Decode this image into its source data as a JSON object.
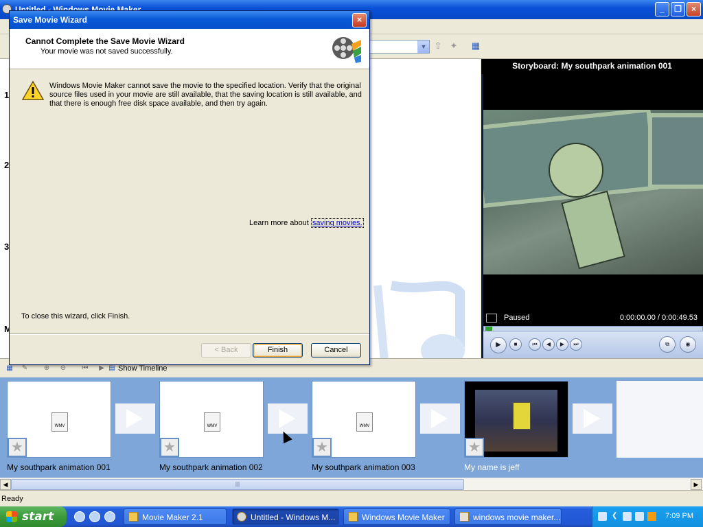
{
  "main_window": {
    "title": "Untitled - Windows Movie Maker",
    "collection_numbers": [
      "1",
      "2",
      "3",
      "M"
    ]
  },
  "preview": {
    "title": "Storyboard: My southpark animation 001",
    "status": "Paused",
    "time": "0:00:00.00 / 0:00:49.53"
  },
  "dialog": {
    "title": "Save Movie Wizard",
    "heading": "Cannot Complete the Save Movie Wizard",
    "subheading": "Your movie was not saved successfully.",
    "message": "Windows Movie Maker cannot save the movie to the specified location. Verify that the original source files used in your movie are still available, that the saving location is still available, and that there is enough free disk space available, and then try again.",
    "learn_more_prefix": "Learn more about",
    "learn_more_link": "saving movies.",
    "close_note": "To close this wizard, click Finish.",
    "back_label": "< Back",
    "finish_label": "Finish",
    "cancel_label": "Cancel"
  },
  "timeline_toolbar": {
    "show_timeline_label": "Show Timeline"
  },
  "storyboard": {
    "clips": [
      {
        "label": "My southpark animation 001"
      },
      {
        "label": "My southpark animation 002"
      },
      {
        "label": "My southpark animation 003"
      },
      {
        "label": "My name is jeff"
      }
    ]
  },
  "statusbar": {
    "text": "Ready"
  },
  "taskbar": {
    "start_label": "start",
    "tasks": [
      {
        "label": "Movie Maker 2.1"
      },
      {
        "label": "Untitled - Windows M..."
      },
      {
        "label": "Windows Movie Maker"
      },
      {
        "label": "windows movie maker..."
      }
    ],
    "clock": "7:09 PM"
  },
  "colors": {
    "titlebar_blue": "#0a52d8",
    "storyboard_bg": "#7ea6d8",
    "taskbar_blue": "#245edb",
    "start_green": "#3c9a3c"
  }
}
